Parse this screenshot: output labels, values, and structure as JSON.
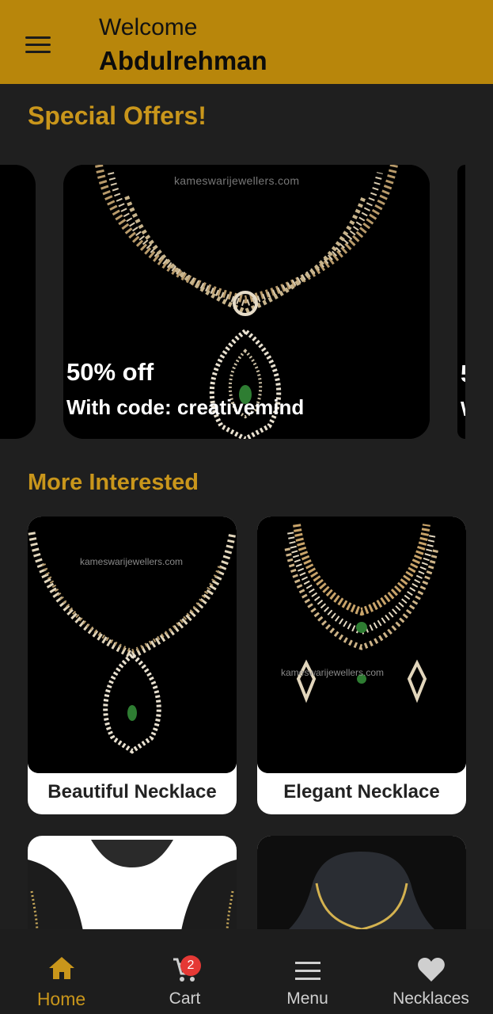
{
  "header": {
    "welcome": "Welcome",
    "username": "Abdulrehman"
  },
  "sections": {
    "special_offers": "Special Offers!",
    "more_interested": "More Interested"
  },
  "carousel": {
    "watermark": "kameswarijewellers.com",
    "offer": {
      "title": "50% off",
      "code_line": "With code: creativemind"
    },
    "peek": {
      "title": "5",
      "code_line": "W"
    }
  },
  "products": [
    {
      "name": "Beautiful Necklace",
      "watermark": "kameswarijewellers.com"
    },
    {
      "name": "Elegant Necklace",
      "watermark": "kameswarijewellers.com"
    }
  ],
  "nav": {
    "items": [
      {
        "label": "Home",
        "icon": "home-icon"
      },
      {
        "label": "Cart",
        "icon": "cart-icon",
        "badge": "2"
      },
      {
        "label": "Menu",
        "icon": "menu-icon"
      },
      {
        "label": "Necklaces",
        "icon": "heart-icon"
      }
    ]
  },
  "colors": {
    "primary": "#b8860b",
    "accent_text": "#c9961b",
    "background": "#1f1f1f",
    "badge": "#e53935"
  }
}
